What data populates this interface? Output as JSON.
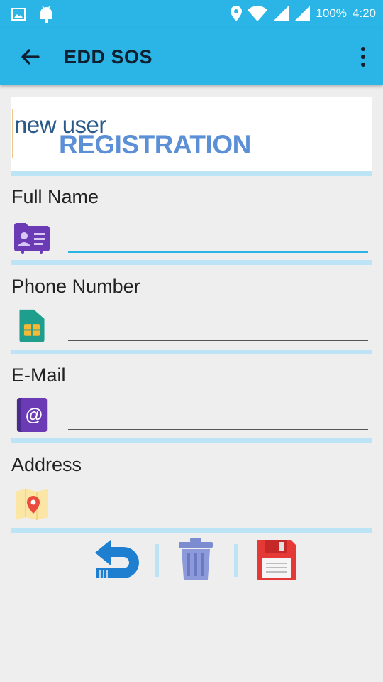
{
  "status_bar": {
    "battery": "100%",
    "time": "4:20",
    "icons": [
      "image-icon",
      "android-icon",
      "location-icon",
      "wifi-icon",
      "signal-icon",
      "battery-icon"
    ]
  },
  "app_bar": {
    "title": "EDD SOS",
    "back_icon": "arrow-back-icon",
    "menu_icon": "more-vert-icon"
  },
  "banner": {
    "line1": "new user",
    "line2": "REGISTRATION"
  },
  "form": {
    "fields": [
      {
        "label": "Full Name",
        "icon": "id-card-icon",
        "value": ""
      },
      {
        "label": "Phone Number",
        "icon": "sim-card-icon",
        "value": ""
      },
      {
        "label": "E-Mail",
        "icon": "email-at-icon",
        "value": ""
      },
      {
        "label": "Address",
        "icon": "map-pin-icon",
        "value": ""
      }
    ]
  },
  "actions": {
    "undo_icon": "undo-icon",
    "delete_icon": "trash-icon",
    "save_icon": "floppy-save-icon"
  },
  "colors": {
    "primary": "#2bb5e6",
    "separator": "#bde3f7",
    "background": "#eeeeee"
  }
}
